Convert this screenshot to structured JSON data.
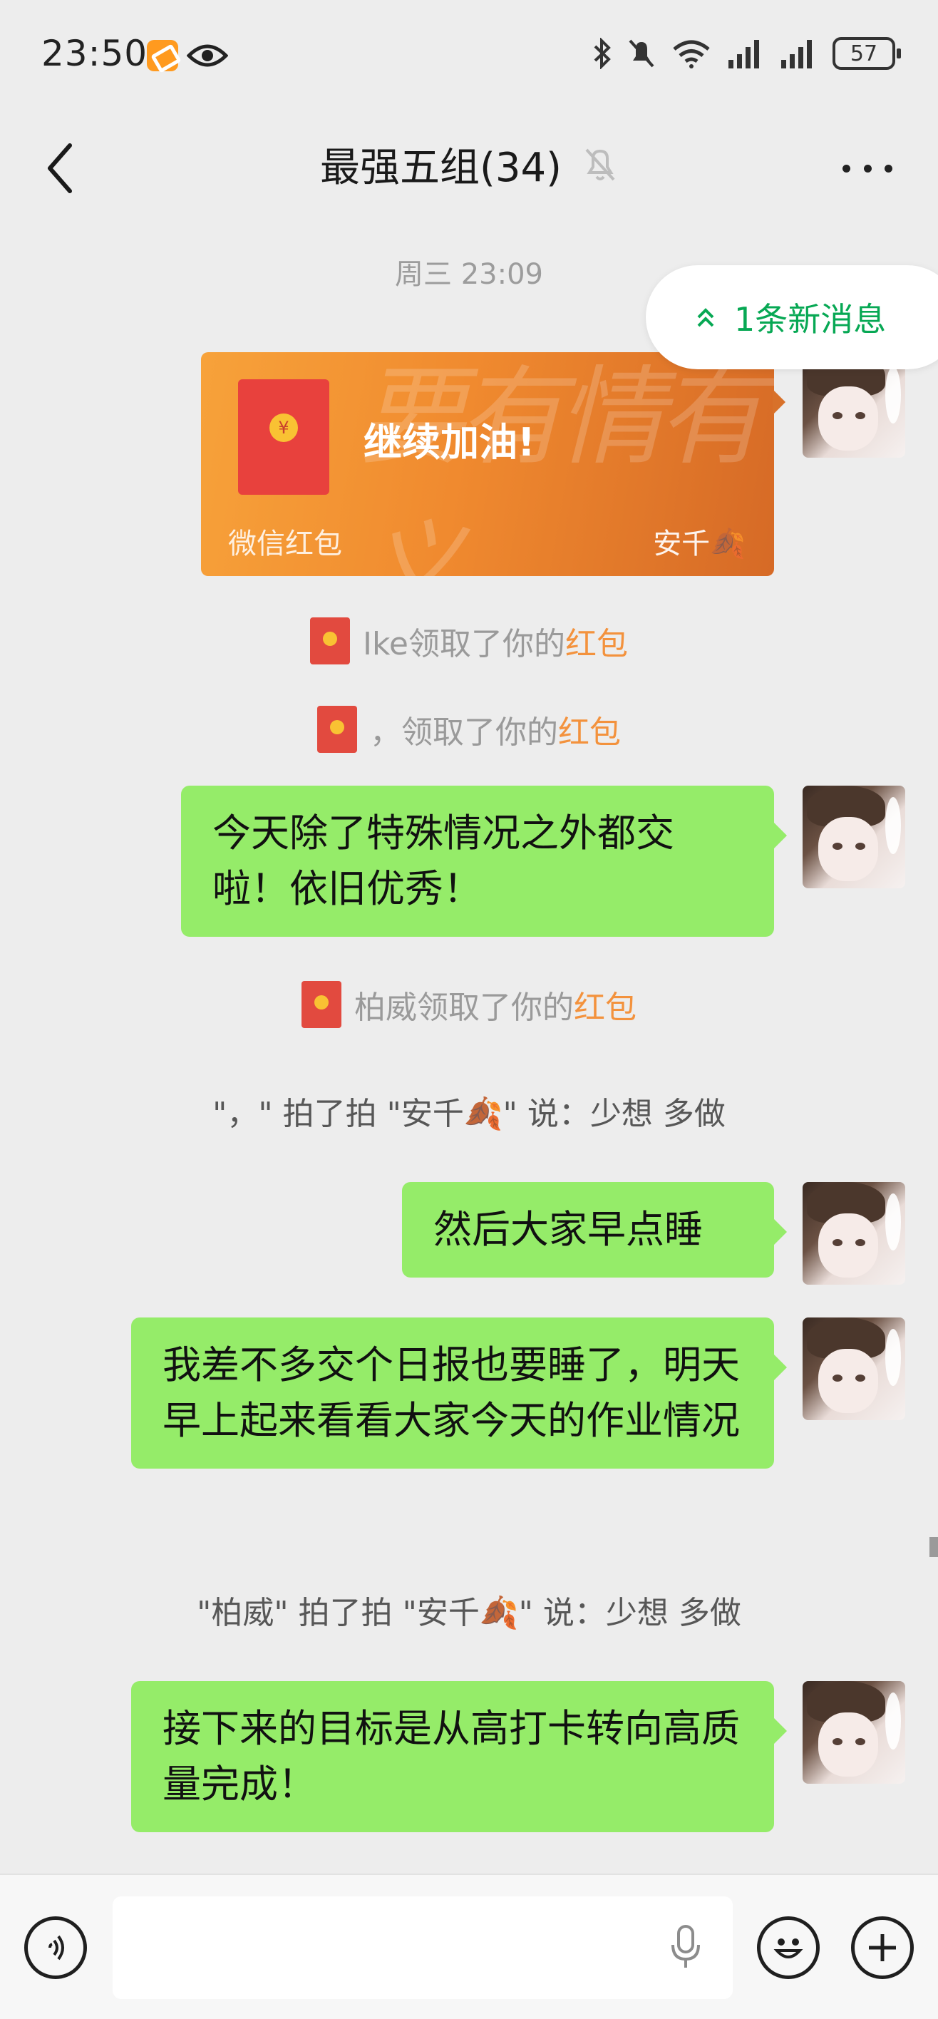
{
  "status_bar": {
    "time": "23:50",
    "battery": "57"
  },
  "header": {
    "title": "最强五组(34)"
  },
  "chat": {
    "timestamp": "周三 23:09",
    "new_messages_pill": "1条新消息",
    "red_packet": {
      "deco_text": "要有情有义",
      "message": "继续加油!",
      "brand": "微信红包",
      "sender": "安千🍂"
    },
    "sys_claims": [
      {
        "name": "Ike",
        "text": "领取了你的",
        "highlight": "红包"
      },
      {
        "name": "，",
        "text": "领取了你的",
        "highlight": "红包"
      },
      {
        "name": "柏威",
        "text": "领取了你的",
        "highlight": "红包"
      }
    ],
    "messages": [
      "今天除了特殊情况之外都交啦！依旧优秀！",
      "然后大家早点睡",
      "我差不多交个日报也要睡了，明天早上起来看看大家今天的作业情况",
      "接下来的目标是从高打卡转向高质量完成！"
    ],
    "pats": [
      "\"，\" 拍了拍 \"安千🍂\" 说：少想 多做",
      "\"柏威\" 拍了拍 \"安千🍂\" 说：少想 多做"
    ]
  },
  "input_bar": {
    "value": ""
  },
  "colors": {
    "bubble": "#95ec69",
    "accent_green": "#07a854",
    "red_packet_orange": "#f08a2f",
    "highlight": "#f3923d"
  },
  "icons": [
    "back-arrow-icon",
    "mute-bell-icon",
    "more-dots-icon",
    "voice-icon",
    "microphone-icon",
    "emoji-icon",
    "plus-icon"
  ]
}
